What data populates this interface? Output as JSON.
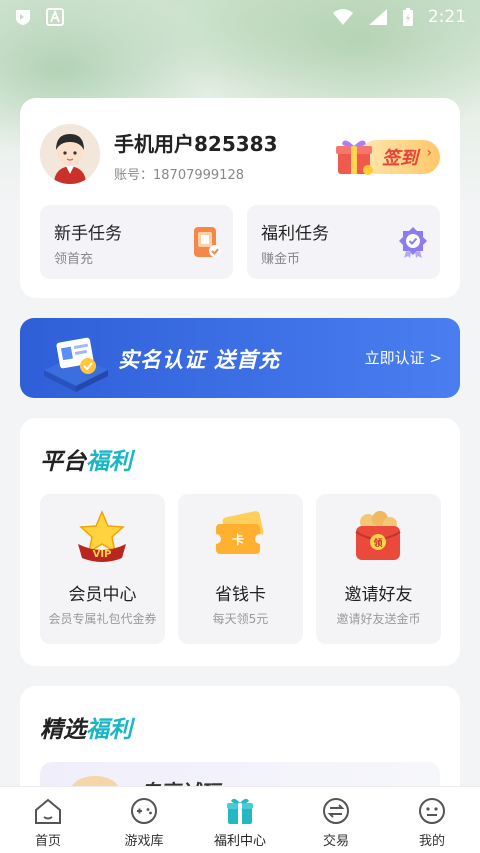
{
  "status_bar": {
    "time": "2:21"
  },
  "profile": {
    "username": "手机用户825383",
    "account_label": "账号：18707999128",
    "checkin_label": "签到",
    "tasks": [
      {
        "title": "新手任务",
        "subtitle": "领首充",
        "icon": "tablet-gift-icon"
      },
      {
        "title": "福利任务",
        "subtitle": "赚金币",
        "icon": "badge-award-icon"
      }
    ]
  },
  "banner": {
    "title": "实名认证 送首充",
    "link": "立即认证 >"
  },
  "platform_benefits": {
    "title_dark": "平台",
    "title_accent": "福利",
    "items": [
      {
        "name": "会员中心",
        "desc": "会员专属礼包代金券",
        "icon": "vip-crown-icon"
      },
      {
        "name": "省钱卡",
        "desc": "每天领5元",
        "icon": "card-ticket-icon"
      },
      {
        "name": "邀请好友",
        "desc": "邀请好友送金币",
        "icon": "red-envelope-icon"
      }
    ]
  },
  "selected_benefits": {
    "title_dark": "精选",
    "title_accent": "福利",
    "trial_label": "专享试玩"
  },
  "tabbar": {
    "items": [
      {
        "label": "首页",
        "icon": "home-icon",
        "active": false
      },
      {
        "label": "游戏库",
        "icon": "gamepad-icon",
        "active": false
      },
      {
        "label": "福利中心",
        "icon": "gift-icon",
        "active": true
      },
      {
        "label": "交易",
        "icon": "trade-icon",
        "active": false
      },
      {
        "label": "我的",
        "icon": "profile-face-icon",
        "active": false
      }
    ]
  },
  "colors": {
    "accent_teal": "#19b6c4",
    "banner_blue": "#2f5fd8",
    "checkin_red": "#e8423a"
  }
}
